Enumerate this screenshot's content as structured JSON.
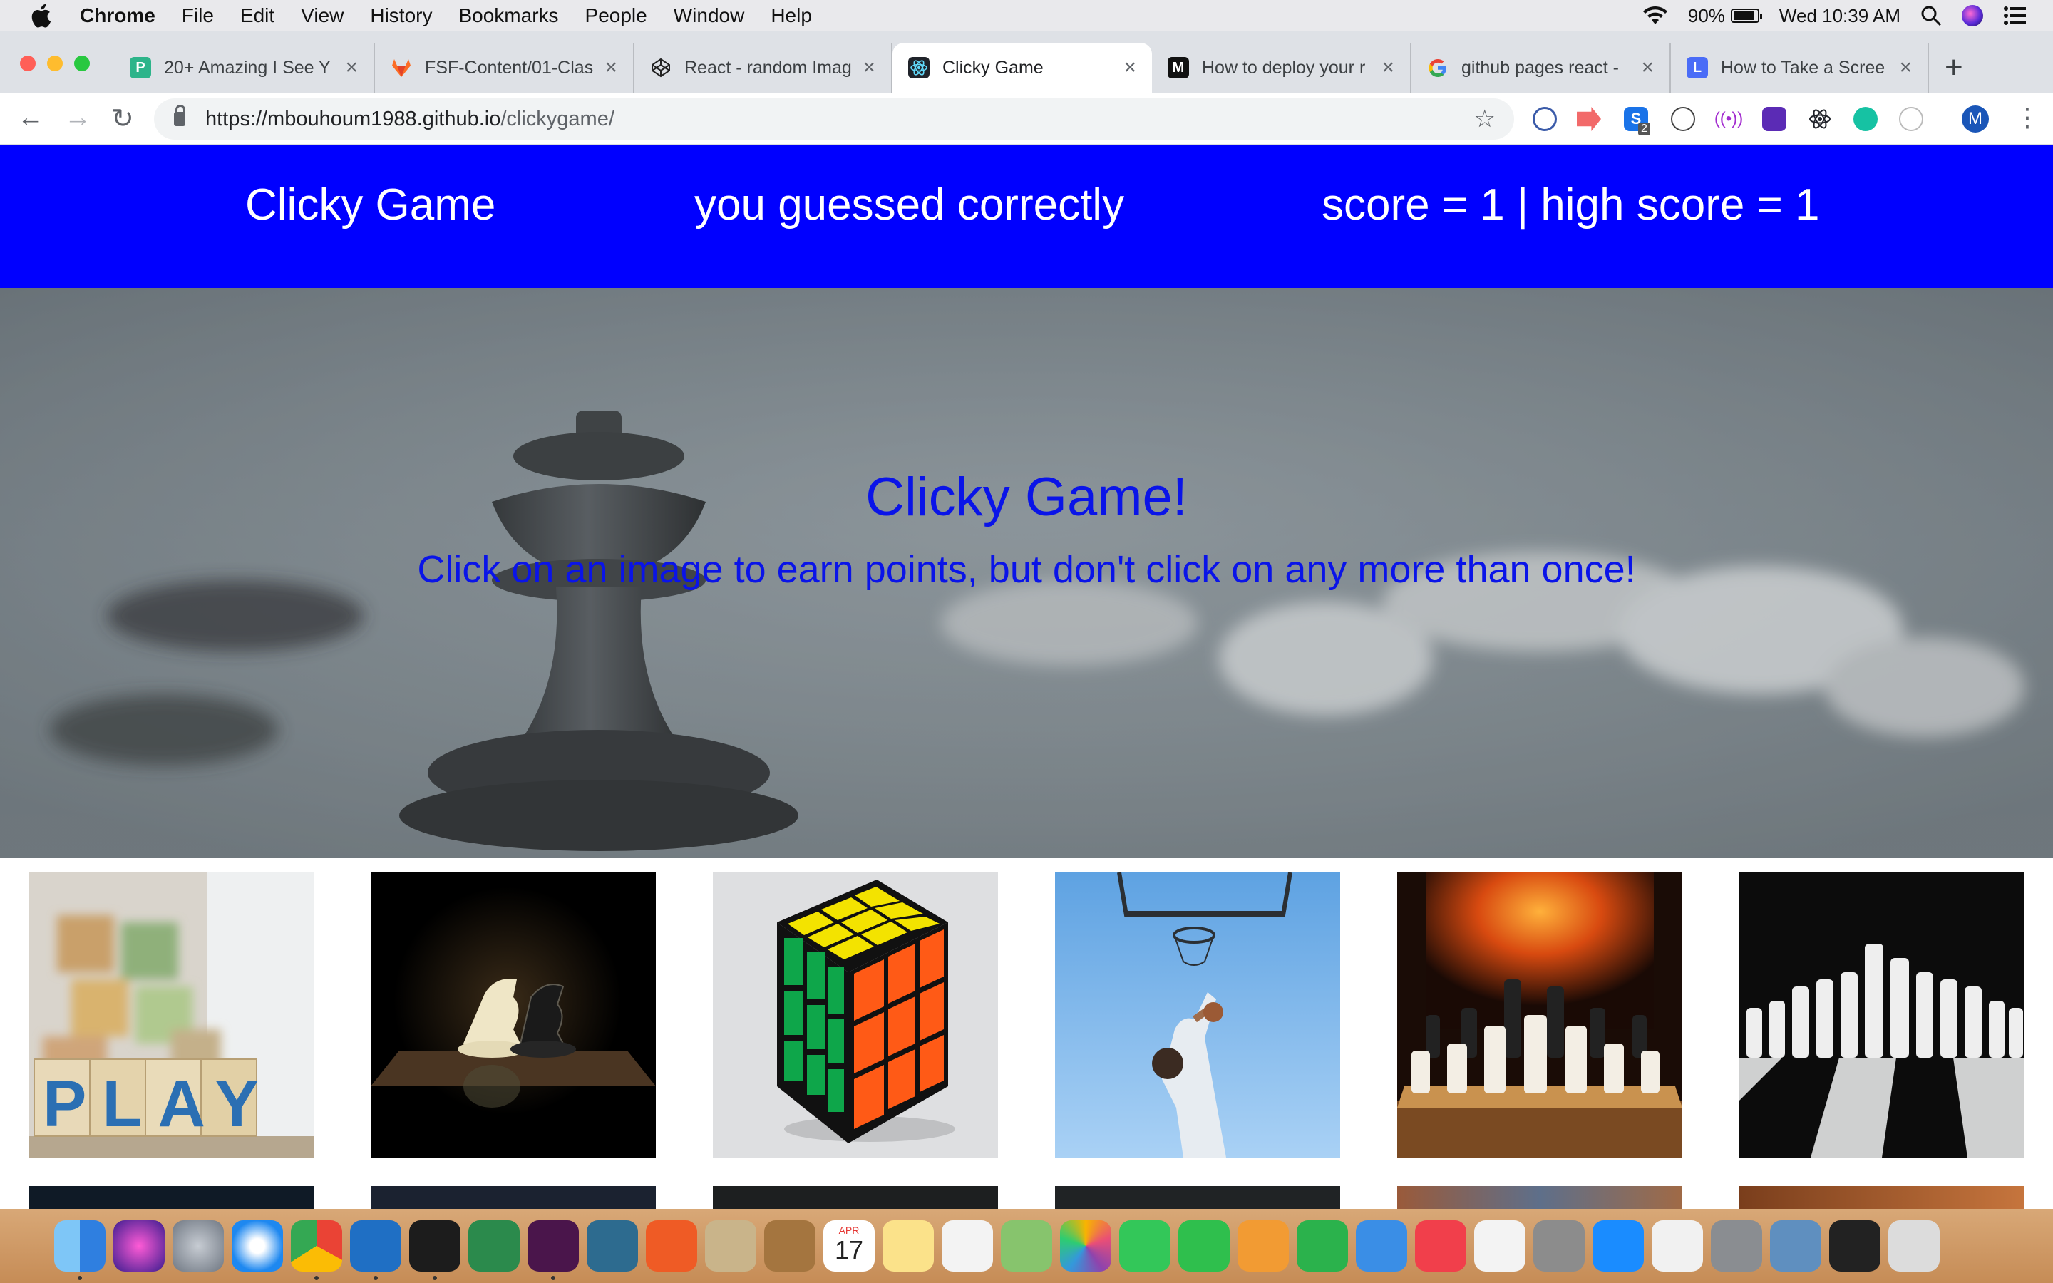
{
  "menubar": {
    "app_name": "Chrome",
    "items": [
      "File",
      "Edit",
      "View",
      "History",
      "Bookmarks",
      "People",
      "Window",
      "Help"
    ],
    "battery": "90%",
    "battery_level": 0.9,
    "clock": "Wed 10:39 AM"
  },
  "browser": {
    "tabs": [
      {
        "title": "20+ Amazing I See Y",
        "icon": "template-site-icon",
        "active": false
      },
      {
        "title": "FSF-Content/01-Clas",
        "icon": "gitlab-icon",
        "active": false
      },
      {
        "title": "React - random Imag",
        "icon": "codepen-icon",
        "active": false
      },
      {
        "title": "Clicky Game",
        "icon": "react-icon",
        "active": true
      },
      {
        "title": "How to deploy your r",
        "icon": "medium-icon",
        "active": false
      },
      {
        "title": "github pages react -",
        "icon": "google-icon",
        "active": false
      },
      {
        "title": "How to Take a Scree",
        "icon": "blue-l-icon",
        "active": false
      }
    ],
    "url_host": "https://mbouhoum1988.github.io",
    "url_path": "/clickygame/",
    "profile_initial": "M",
    "extension_badge": "2"
  },
  "page": {
    "navbar": {
      "brand": "Clicky Game",
      "message": "you guessed correctly",
      "score": "score = 1 | high score = 1"
    },
    "jumbotron": {
      "title": "Clicky Game!",
      "subtitle": "Click on an image to earn points, but don't click on any more than once!"
    },
    "cards": [
      {
        "subject": "play-blocks",
        "text": "PLAY"
      },
      {
        "subject": "chess-knights"
      },
      {
        "subject": "rubiks-cube"
      },
      {
        "subject": "basketball-dunk"
      },
      {
        "subject": "chess-fireplace"
      },
      {
        "subject": "chess-white-pieces"
      },
      {
        "subject": "row-2-card-1"
      },
      {
        "subject": "row-2-card-2"
      },
      {
        "subject": "row-2-card-3"
      },
      {
        "subject": "row-2-card-4"
      },
      {
        "subject": "row-2-card-5"
      },
      {
        "subject": "row-2-card-6"
      }
    ]
  },
  "dock": {
    "apps": [
      "finder",
      "siri",
      "launchpad",
      "safari",
      "chrome",
      "vscode",
      "terminal",
      "gitkraken",
      "slack",
      "mysql-workbench",
      "postman",
      "preview-mail",
      "notes-brown",
      "calendar",
      "notes",
      "reminders",
      "maps",
      "photos",
      "messages",
      "facetime",
      "pages",
      "numbers",
      "keynote",
      "news",
      "music",
      "automator",
      "app-store",
      "textedit",
      "system-preferences",
      "image-capture",
      "activity-monitor",
      "trash"
    ],
    "calendar_month": "APR",
    "calendar_day": "17"
  }
}
